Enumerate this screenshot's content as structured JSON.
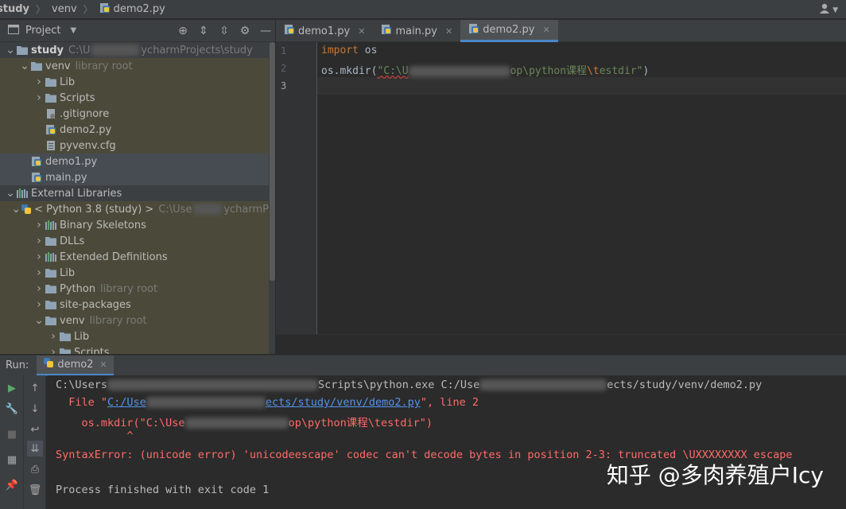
{
  "breadcrumb": {
    "items": [
      "study",
      "venv",
      "demo2.py"
    ]
  },
  "project": {
    "title": "Project",
    "tree": [
      {
        "label": "study",
        "dim": "C:\\U",
        "dim2": "ycharmProjects\\study",
        "depth": 0,
        "arrow": "down",
        "icon": "folder-icon",
        "bold": true
      },
      {
        "label": "venv",
        "dim": "library root",
        "depth": 1,
        "arrow": "down",
        "icon": "folder-icon",
        "bg": "olive"
      },
      {
        "label": "Lib",
        "depth": 2,
        "arrow": "right",
        "icon": "folder-icon",
        "bg": "olive"
      },
      {
        "label": "Scripts",
        "depth": 2,
        "arrow": "right",
        "icon": "folder-icon",
        "bg": "olive"
      },
      {
        "label": ".gitignore",
        "depth": 2,
        "icon": "gitignore-file-icon",
        "bg": "olive"
      },
      {
        "label": "demo2.py",
        "depth": 2,
        "icon": "python-file-icon",
        "bg": "olive"
      },
      {
        "label": "pyvenv.cfg",
        "depth": 2,
        "icon": "text-file-icon",
        "bg": "olive"
      },
      {
        "label": "demo1.py",
        "depth": 1,
        "icon": "python-file-icon",
        "bg": "sel"
      },
      {
        "label": "main.py",
        "depth": 1,
        "icon": "python-file-icon",
        "bg": "sel"
      },
      {
        "label": "External Libraries",
        "depth": 0,
        "arrow": "down",
        "icon": "library-icon"
      },
      {
        "label": "< Python 3.8 (study) >",
        "dim": "C:\\Use",
        "dim2": "ycharmP",
        "depth": 1,
        "arrow": "down",
        "icon": "python-sdk-icon",
        "bg": "olive"
      },
      {
        "label": "Binary Skeletons",
        "depth": 2,
        "arrow": "right",
        "icon": "library-icon",
        "bg": "olive"
      },
      {
        "label": "DLLs",
        "depth": 2,
        "arrow": "right",
        "icon": "folder-icon",
        "bg": "olive"
      },
      {
        "label": "Extended Definitions",
        "depth": 2,
        "arrow": "right",
        "icon": "library-icon",
        "bg": "olive"
      },
      {
        "label": "Lib",
        "depth": 2,
        "arrow": "right",
        "icon": "folder-icon",
        "bg": "olive"
      },
      {
        "label": "Python",
        "dim": "library root",
        "depth": 2,
        "arrow": "right",
        "icon": "folder-icon",
        "bg": "olive"
      },
      {
        "label": "site-packages",
        "depth": 2,
        "arrow": "right",
        "icon": "folder-icon",
        "bg": "olive"
      },
      {
        "label": "venv",
        "dim": "library root",
        "depth": 2,
        "arrow": "down",
        "icon": "folder-icon",
        "bg": "olive"
      },
      {
        "label": "Lib",
        "depth": 3,
        "arrow": "right",
        "icon": "folder-icon",
        "bg": "olive"
      },
      {
        "label": "Scripts",
        "depth": 3,
        "arrow": "right",
        "icon": "folder-icon",
        "bg": "olive"
      }
    ]
  },
  "editor": {
    "tabs": [
      {
        "label": "demo1.py",
        "active": false
      },
      {
        "label": "main.py",
        "active": false
      },
      {
        "label": "demo2.py",
        "active": true
      }
    ],
    "line_numbers": [
      "1",
      "2",
      "3"
    ],
    "code": {
      "line1_kw": "import",
      "line1_rest": " os",
      "line2_fn": "os.mkdir(",
      "line2_str_a": "\"C:\\U",
      "line2_str_b": "op\\python课程",
      "line2_esc": "\\t",
      "line2_str_c": "estdir\"",
      "line2_end": ")"
    }
  },
  "run": {
    "label": "Run:",
    "tab": "demo2",
    "console": {
      "l1a": "C:\\Users",
      "l1b": "Scripts\\python.exe C:/Use",
      "l1c": "ects/study/venv/demo2.py",
      "l2a": "  File \"",
      "l2link_a": "C:/Use",
      "l2link_b": "ects/study/venv/demo2.py",
      "l2b": "\", line 2",
      "l3a": "    os.mkdir(\"C:\\Use",
      "l3b": "op\\python课程\\testdir\")",
      "l4": "           ^",
      "l5": "SyntaxError: (unicode error) 'unicodeescape' codec can't decode bytes in position 2-3: truncated \\UXXXXXXXX escape",
      "l6": "Process finished with exit code 1"
    }
  },
  "watermark": "知乎 @多肉养殖户Icy"
}
